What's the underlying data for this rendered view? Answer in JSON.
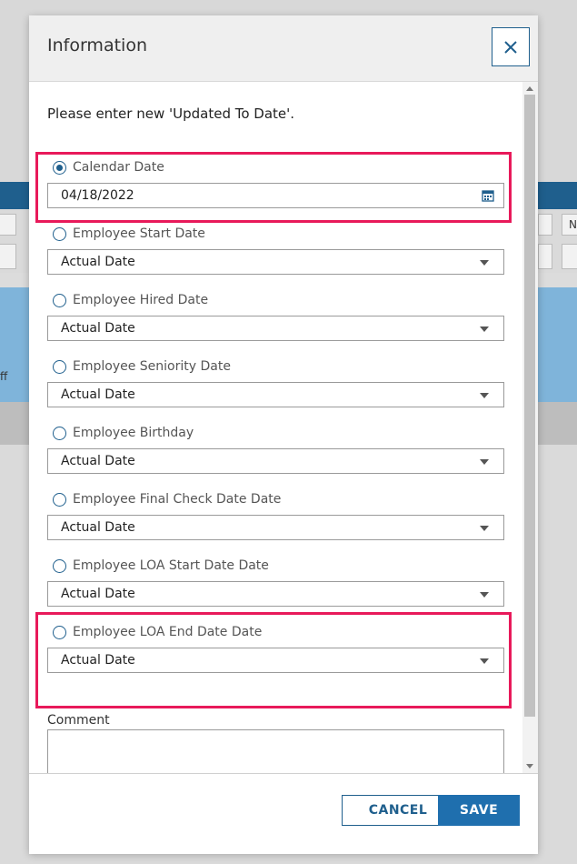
{
  "background": {
    "cell_text": "ff",
    "col_text": "N"
  },
  "dialog": {
    "title": "Information",
    "instruction": "Please enter new 'Updated To Date'.",
    "options": [
      {
        "label": "Calendar Date",
        "selected": true,
        "value": "04/18/2022",
        "kind": "date"
      },
      {
        "label": "Employee Start Date",
        "selected": false,
        "value": "Actual Date",
        "kind": "select"
      },
      {
        "label": "Employee Hired Date",
        "selected": false,
        "value": "Actual Date",
        "kind": "select"
      },
      {
        "label": "Employee Seniority Date",
        "selected": false,
        "value": "Actual Date",
        "kind": "select"
      },
      {
        "label": "Employee Birthday",
        "selected": false,
        "value": "Actual Date",
        "kind": "select"
      },
      {
        "label": "Employee Final Check Date Date",
        "selected": false,
        "value": "Actual Date",
        "kind": "select"
      },
      {
        "label": "Employee LOA Start Date Date",
        "selected": false,
        "value": "Actual Date",
        "kind": "select"
      },
      {
        "label": "Employee LOA End Date Date",
        "selected": false,
        "value": "Actual Date",
        "kind": "select"
      }
    ],
    "comment_label": "Comment",
    "comment_value": "",
    "cancel_label": "CANCEL",
    "save_label": "SAVE"
  },
  "colors": {
    "primary": "#1f5f8d",
    "highlight": "#e8195a",
    "selected_row": "#7fb4da"
  },
  "icons": [
    "close-icon",
    "calendar-icon",
    "chevron-down-icon"
  ]
}
